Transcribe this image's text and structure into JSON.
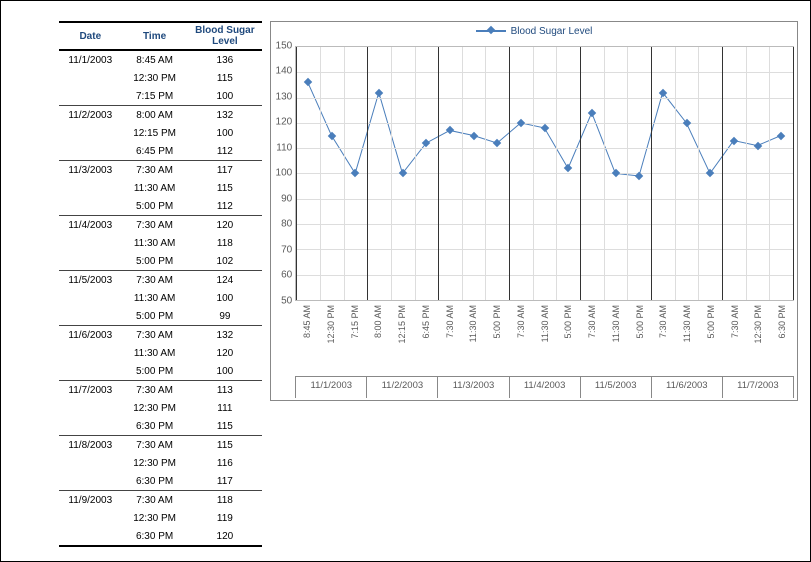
{
  "table": {
    "headers": [
      "Date",
      "Time",
      "Blood Sugar Level"
    ],
    "rows": [
      {
        "date": "11/1/2003",
        "time": "8:45 AM",
        "level": 136,
        "group_start": true
      },
      {
        "date": "",
        "time": "12:30 PM",
        "level": 115
      },
      {
        "date": "",
        "time": "7:15 PM",
        "level": 100
      },
      {
        "date": "11/2/2003",
        "time": "8:00 AM",
        "level": 132,
        "group_start": true
      },
      {
        "date": "",
        "time": "12:15 PM",
        "level": 100
      },
      {
        "date": "",
        "time": "6:45 PM",
        "level": 112
      },
      {
        "date": "11/3/2003",
        "time": "7:30 AM",
        "level": 117,
        "group_start": true
      },
      {
        "date": "",
        "time": "11:30 AM",
        "level": 115
      },
      {
        "date": "",
        "time": "5:00 PM",
        "level": 112
      },
      {
        "date": "11/4/2003",
        "time": "7:30 AM",
        "level": 120,
        "group_start": true
      },
      {
        "date": "",
        "time": "11:30 AM",
        "level": 118
      },
      {
        "date": "",
        "time": "5:00 PM",
        "level": 102
      },
      {
        "date": "11/5/2003",
        "time": "7:30 AM",
        "level": 124,
        "group_start": true
      },
      {
        "date": "",
        "time": "11:30 AM",
        "level": 100
      },
      {
        "date": "",
        "time": "5:00 PM",
        "level": 99
      },
      {
        "date": "11/6/2003",
        "time": "7:30 AM",
        "level": 132,
        "group_start": true
      },
      {
        "date": "",
        "time": "11:30 AM",
        "level": 120
      },
      {
        "date": "",
        "time": "5:00 PM",
        "level": 100
      },
      {
        "date": "11/7/2003",
        "time": "7:30 AM",
        "level": 113,
        "group_start": true
      },
      {
        "date": "",
        "time": "12:30 PM",
        "level": 111
      },
      {
        "date": "",
        "time": "6:30 PM",
        "level": 115
      },
      {
        "date": "11/8/2003",
        "time": "7:30 AM",
        "level": 115,
        "group_start": true
      },
      {
        "date": "",
        "time": "12:30 PM",
        "level": 116
      },
      {
        "date": "",
        "time": "6:30 PM",
        "level": 117
      },
      {
        "date": "11/9/2003",
        "time": "7:30 AM",
        "level": 118,
        "group_start": true
      },
      {
        "date": "",
        "time": "12:30 PM",
        "level": 119
      },
      {
        "date": "",
        "time": "6:30 PM",
        "level": 120
      }
    ]
  },
  "chart_data": {
    "type": "line",
    "title": "",
    "xlabel": "",
    "ylabel": "",
    "ylim": [
      50,
      150
    ],
    "yticks": [
      50,
      60,
      70,
      80,
      90,
      100,
      110,
      120,
      130,
      140,
      150
    ],
    "x_groups": [
      "11/1/2003",
      "11/2/2003",
      "11/3/2003",
      "11/4/2003",
      "11/5/2003",
      "11/6/2003",
      "11/7/2003"
    ],
    "categories": [
      "8:45 AM",
      "12:30 PM",
      "7:15 PM",
      "8:00 AM",
      "12:15 PM",
      "6:45 PM",
      "7:30 AM",
      "11:30 AM",
      "5:00 PM",
      "7:30 AM",
      "11:30 AM",
      "5:00 PM",
      "7:30 AM",
      "11:30 AM",
      "5:00 PM",
      "7:30 AM",
      "11:30 AM",
      "5:00 PM",
      "7:30 AM",
      "12:30 PM",
      "6:30 PM"
    ],
    "series": [
      {
        "name": "Blood Sugar Level",
        "values": [
          136,
          115,
          100,
          132,
          100,
          112,
          117,
          115,
          112,
          120,
          118,
          102,
          124,
          100,
          99,
          132,
          120,
          100,
          113,
          111,
          115
        ]
      }
    ],
    "line_color": "#4A7EBB"
  }
}
